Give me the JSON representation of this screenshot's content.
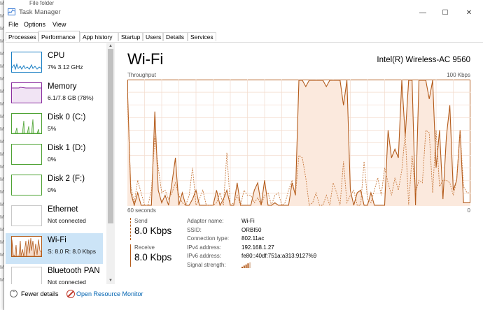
{
  "background_window": {
    "title_fragment": "File folder"
  },
  "window": {
    "title": "Task Manager",
    "minimize_glyph": "—",
    "maximize_glyph": "☐",
    "close_glyph": "✕"
  },
  "menu": [
    "File",
    "Options",
    "View"
  ],
  "tabs": [
    "Processes",
    "Performance",
    "App history",
    "Startup",
    "Users",
    "Details",
    "Services"
  ],
  "active_tab": "Performance",
  "sidebar": {
    "items": [
      {
        "name": "CPU",
        "sub": "7%  3.12 GHz",
        "color": "#1a7fc4"
      },
      {
        "name": "Memory",
        "sub": "6.1/7.8 GB (78%)",
        "color": "#8b2fa0"
      },
      {
        "name": "Disk 0 (C:)",
        "sub": "5%",
        "color": "#4da233"
      },
      {
        "name": "Disk 1 (D:)",
        "sub": "0%",
        "color": "#4da233"
      },
      {
        "name": "Disk 2 (F:)",
        "sub": "0%",
        "color": "#4da233"
      },
      {
        "name": "Ethernet",
        "sub": "Not connected",
        "color": "#a7a7a7"
      },
      {
        "name": "Wi-Fi",
        "sub": "S: 8.0  R: 8.0 Kbps",
        "color": "#b35b1b"
      },
      {
        "name": "Bluetooth PAN",
        "sub": "Not connected",
        "color": "#a7a7a7"
      }
    ],
    "selected": "Wi-Fi"
  },
  "main": {
    "title": "Wi-Fi",
    "adapter_name": "Intel(R) Wireless-AC 9560",
    "throughput_label": "Throughput",
    "max_label": "100 Kbps",
    "x_left_label": "60 seconds",
    "x_right_label": "0",
    "send_label": "Send",
    "send_value": "8.0 Kbps",
    "receive_label": "Receive",
    "receive_value": "8.0 Kbps",
    "details": [
      {
        "key": "Adapter name:",
        "value": "Wi-Fi"
      },
      {
        "key": "SSID:",
        "value": "ORBI50"
      },
      {
        "key": "Connection type:",
        "value": "802.11ac"
      },
      {
        "key": "IPv4 address:",
        "value": "192.168.1.27"
      },
      {
        "key": "IPv6 address:",
        "value": "fe80::40df:751a:a313:9127%9"
      },
      {
        "key": "Signal strength:",
        "value": ""
      }
    ],
    "accent_color": "#b35b1b",
    "signal_bars": 4
  },
  "chart_data": {
    "type": "area",
    "xlim": [
      60,
      0
    ],
    "ylim": [
      0,
      100
    ],
    "series": [
      {
        "values": [
          95,
          10,
          0,
          10,
          0,
          0,
          0,
          0,
          75,
          12,
          2,
          8,
          0,
          18,
          38,
          0,
          10,
          0,
          0,
          5,
          12,
          0,
          0,
          0,
          0,
          0,
          12,
          0,
          5,
          12,
          0,
          0,
          18,
          0,
          0,
          0,
          0,
          12,
          18,
          0,
          20,
          0,
          0,
          2,
          0,
          0,
          0,
          0,
          18,
          8,
          100,
          100,
          95,
          100,
          100,
          100,
          100,
          100,
          95,
          100,
          100,
          100,
          100,
          80,
          100,
          12,
          0,
          10,
          12,
          0,
          0,
          10,
          0,
          0,
          0,
          0,
          60,
          38,
          45,
          38,
          100,
          55,
          100,
          100,
          0,
          100,
          100,
          100,
          85,
          100,
          30,
          60,
          5,
          55,
          80,
          12,
          20,
          60,
          2,
          2,
          2
        ]
      },
      {
        "values": [
          85,
          15,
          2,
          20,
          10,
          0,
          0,
          12,
          55,
          30,
          10,
          12,
          5,
          10,
          18,
          8,
          2,
          0,
          8,
          30,
          0,
          5,
          12,
          0,
          0,
          0,
          2,
          10,
          0,
          42,
          0,
          2,
          8,
          0,
          12,
          8,
          8,
          2,
          6,
          0,
          8,
          10,
          0,
          8,
          10,
          0,
          2,
          12,
          20,
          8,
          40,
          38,
          22,
          0,
          2,
          10,
          0,
          0,
          8,
          0,
          18,
          10,
          0,
          35,
          2,
          8,
          12,
          0,
          0,
          35,
          5,
          2,
          12,
          22,
          8,
          30,
          18,
          8,
          22,
          12,
          28,
          58,
          0,
          40,
          10,
          20,
          18,
          60,
          58,
          10,
          60,
          15,
          20,
          20,
          18,
          8,
          20,
          60,
          15,
          10,
          10
        ]
      }
    ]
  }
}
